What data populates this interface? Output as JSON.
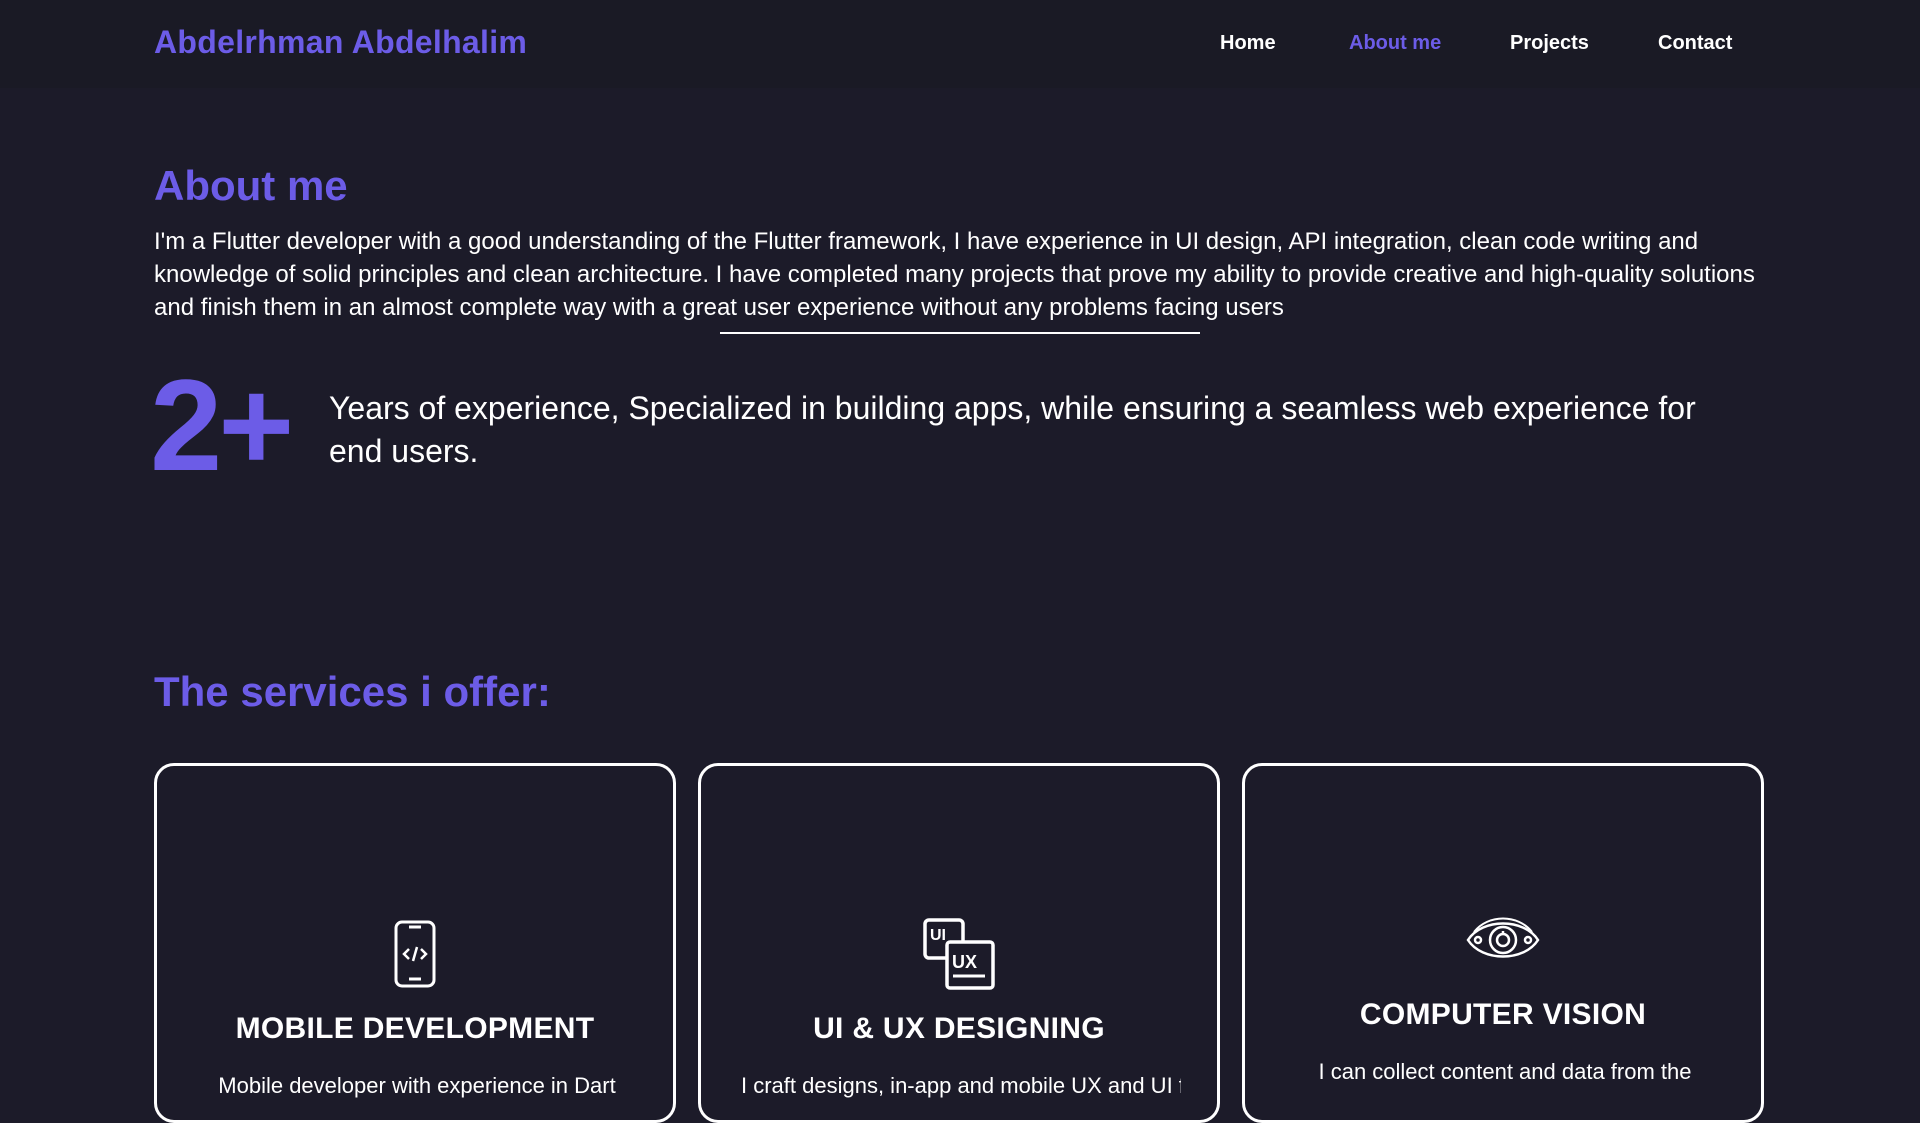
{
  "brand": "Abdelrhman Abdelhalim",
  "nav": {
    "items": [
      {
        "label": "Home",
        "active": false
      },
      {
        "label": "About me",
        "active": true
      },
      {
        "label": "Projects",
        "active": false
      },
      {
        "label": "Contact",
        "active": false
      }
    ]
  },
  "about": {
    "title": "About me",
    "text": "I'm a Flutter developer with a good understanding of the Flutter framework, I have experience in UI design, API integration, clean code writing and knowledge of solid principles and clean architecture. I have completed many projects that prove my ability to provide creative and high-quality solutions and finish them in an almost complete way with a great user experience without any problems facing users",
    "years": "2+",
    "experience_text": "Years of experience, Specialized in building apps, while ensuring a seamless web experience for end users."
  },
  "services": {
    "title": "The services i offer:",
    "cards": [
      {
        "icon": "mobile-code-icon",
        "title": "MOBILE DEVELOPMENT",
        "desc": "Mobile developer with experience in Dart"
      },
      {
        "icon": "ui-ux-icon",
        "title": "UI & UX DESIGNING",
        "desc": "I craft designs, in-app and mobile UX and UI for"
      },
      {
        "icon": "eye-icon",
        "title": "COMPUTER VISION",
        "desc": "I can collect content and data from the"
      }
    ]
  },
  "colors": {
    "accent": "#6c5ce7",
    "background": "#1c1b29",
    "navbar": "#1a1a25",
    "text": "#ffffff"
  }
}
